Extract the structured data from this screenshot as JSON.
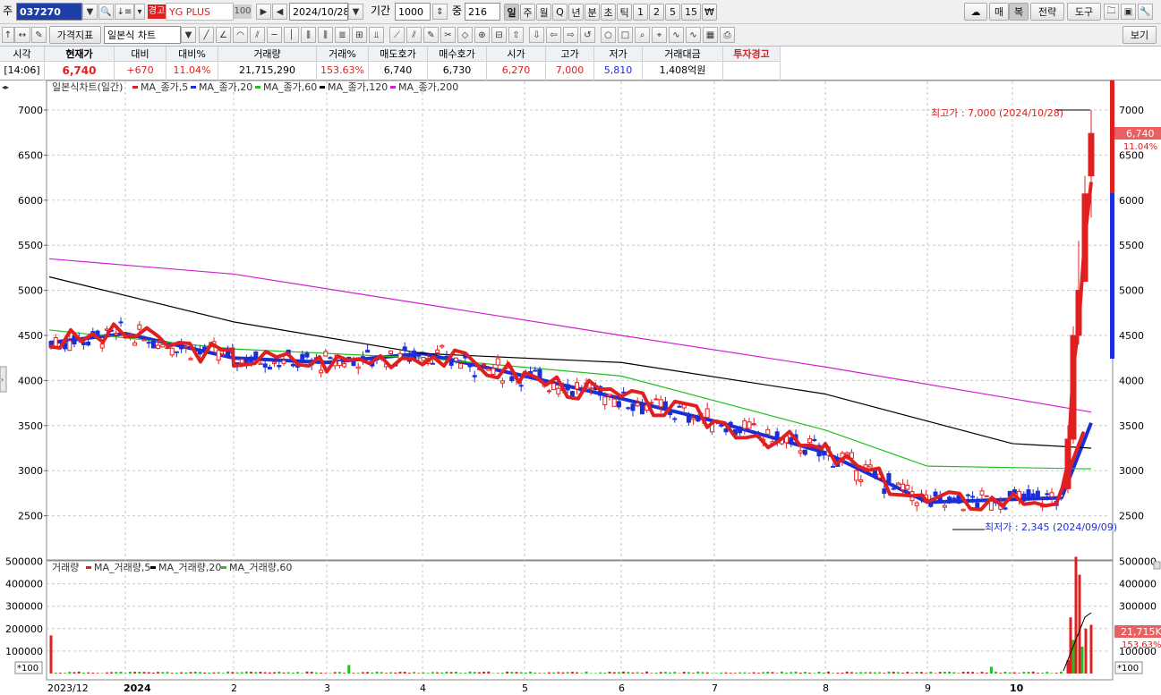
{
  "toolbar1": {
    "code_label": "주",
    "stock_code": "037270",
    "warn_badge": "경고",
    "stock_name": "YG PLUS",
    "pct_box": "100",
    "date": "2024/10/28",
    "period_label": "기간",
    "period_value": "1000",
    "zoom_label": "중",
    "zoom_value": "216",
    "tabs": [
      "일",
      "주",
      "월",
      "Q",
      "년",
      "분",
      "초",
      "틱",
      "1",
      "2",
      "5",
      "15",
      "₩"
    ],
    "right_buttons": [
      "매",
      "복",
      "전략",
      "도구"
    ]
  },
  "toolbar2": {
    "indicator_button": "가격지표",
    "chart_type": "일본식 차트",
    "view_button": "보기"
  },
  "quote": {
    "headers": [
      "시각",
      "현재가",
      "대비",
      "대비%",
      "거래량",
      "거래%",
      "매도호가",
      "매수호가",
      "시가",
      "고가",
      "저가",
      "거래대금",
      "투자경고"
    ],
    "values": [
      "[14:06]",
      "6,740",
      "+670",
      "11.04%",
      "21,715,290",
      "153.63%",
      "6,740",
      "6,730",
      "6,270",
      "7,000",
      "5,810",
      "1,408억원",
      ""
    ]
  },
  "price_panel": {
    "title": "일본식차트(일간)",
    "legend": [
      "MA_종가,5",
      "MA_종가,20",
      "MA_종가,60",
      "MA_종가,120",
      "MA_종가,200"
    ],
    "legend_colors": [
      "#e02020",
      "#e02020",
      "#1a2fd8",
      "#22c022",
      "#000000",
      "#d020d0"
    ],
    "y_ticks": [
      "7000",
      "6500",
      "6000",
      "5500",
      "5000",
      "4500",
      "4000",
      "3500",
      "3000",
      "2500"
    ],
    "high_note": "최고가 : 7,000 (2024/10/28)",
    "low_note": "최저가 : 2,345 (2024/09/09)",
    "last_price": "6,740",
    "last_pct": "11.04%"
  },
  "volume_panel": {
    "title": "거래량",
    "legend": [
      "MA_거래량,5",
      "MA_거래량,20",
      "MA_거래량,60"
    ],
    "y_ticks": [
      "500000",
      "400000",
      "300000",
      "200000",
      "100000"
    ],
    "unit": "*100",
    "last_volume": "21,715K",
    "last_pct": "153.63%"
  },
  "x_axis": {
    "labels": [
      "2023/12",
      "2024",
      "2",
      "3",
      "4",
      "5",
      "6",
      "7",
      "8",
      "9",
      "10"
    ]
  },
  "chart_data": {
    "type": "candlestick",
    "title": "일본식차트(일간)",
    "ylim": [
      2200,
      7300
    ],
    "x_period": [
      "2023/12",
      "2024/10/28"
    ],
    "ma_series": [
      {
        "name": "MA_종가,20",
        "color": "#1a2fd8",
        "points": [
          [
            "2023/12",
            4420
          ],
          [
            "2024/01",
            4520
          ],
          [
            "2024/02",
            4250
          ],
          [
            "2024/03",
            4200
          ],
          [
            "2024/04",
            4300
          ],
          [
            "2024/05",
            4050
          ],
          [
            "2024/06",
            3800
          ],
          [
            "2024/07",
            3550
          ],
          [
            "2024/08",
            3200
          ],
          [
            "2024/09",
            2650
          ],
          [
            "2024/10/21",
            2700
          ],
          [
            "2024/10/28",
            3530
          ]
        ]
      },
      {
        "name": "MA_종가,60",
        "color": "#22c022",
        "points": [
          [
            "2023/12",
            4560
          ],
          [
            "2024/02",
            4350
          ],
          [
            "2024/04",
            4250
          ],
          [
            "2024/06",
            4050
          ],
          [
            "2024/08",
            3450
          ],
          [
            "2024/09",
            3050
          ],
          [
            "2024/10/28",
            3020
          ]
        ]
      },
      {
        "name": "MA_종가,120",
        "color": "#000000",
        "points": [
          [
            "2023/12",
            5150
          ],
          [
            "2024/02",
            4650
          ],
          [
            "2024/04",
            4300
          ],
          [
            "2024/06",
            4200
          ],
          [
            "2024/08",
            3850
          ],
          [
            "2024/10",
            3300
          ],
          [
            "2024/10/28",
            3250
          ]
        ]
      },
      {
        "name": "MA_종가,200",
        "color": "#d020d0",
        "points": [
          [
            "2023/12",
            5350
          ],
          [
            "2024/02",
            5180
          ],
          [
            "2024/04",
            4850
          ],
          [
            "2024/06",
            4500
          ],
          [
            "2024/08",
            4150
          ],
          [
            "2024/10/28",
            3650
          ]
        ]
      }
    ],
    "recent_candles": [
      {
        "date": "2024/10/22",
        "open": 2800,
        "high": 3500,
        "low": 2750,
        "close": 3350
      },
      {
        "date": "2024/10/23",
        "open": 3350,
        "high": 4600,
        "low": 3300,
        "close": 4500
      },
      {
        "date": "2024/10/24",
        "open": 4500,
        "high": 5550,
        "low": 4400,
        "close": 5000
      },
      {
        "date": "2024/10/25",
        "open": 5100,
        "high": 6270,
        "low": 5800,
        "close": 6070
      },
      {
        "date": "2024/10/28",
        "open": 6270,
        "high": 7000,
        "low": 5810,
        "close": 6740
      }
    ],
    "high": {
      "date": "2024/10/28",
      "value": 7000
    },
    "low": {
      "date": "2024/09/09",
      "value": 2345
    }
  }
}
